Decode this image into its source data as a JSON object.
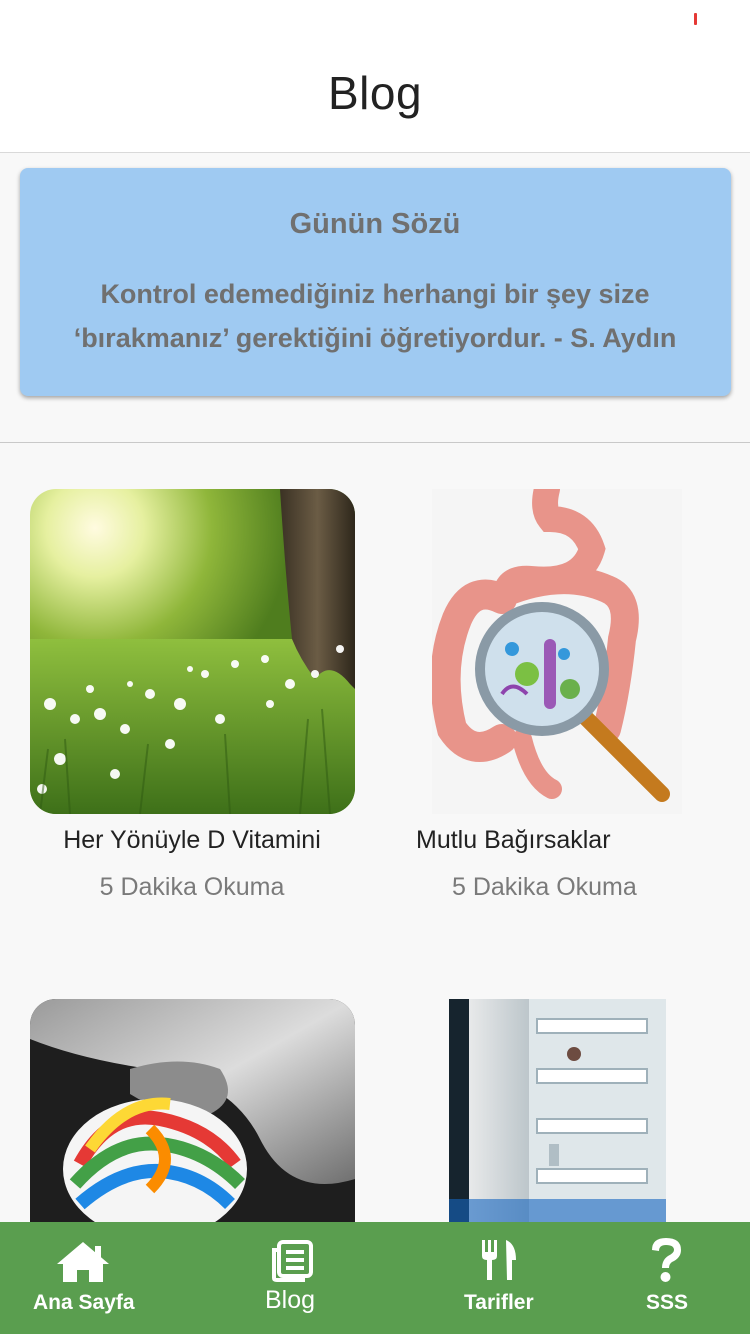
{
  "header": {
    "title": "Blog"
  },
  "quote": {
    "title": "Günün Sözü",
    "line1": "Kontrol edemediğiniz herhangi bir şey size",
    "line2": "‘bırakmanız’ gerektiğini öğretiyordur. - S. Aydın",
    "background": "#9fcaf2"
  },
  "posts": [
    {
      "title": "Her Yönüyle D Vitamini",
      "meta": "5 Dakika Okuma",
      "image": "sunlit-meadow-tree"
    },
    {
      "title": "Mutlu Bağırsaklar",
      "meta": "5 Dakika Okuma",
      "image": "intestine-magnifier"
    },
    {
      "title": "",
      "meta": "",
      "image": "child-lollipop"
    },
    {
      "title": "",
      "meta": "",
      "image": "open-refrigerator"
    }
  ],
  "nav": {
    "background": "#5a9e4f",
    "items": [
      {
        "label": "Ana Sayfa",
        "icon": "home-icon"
      },
      {
        "label": "Blog",
        "icon": "newspaper-icon"
      },
      {
        "label": "Tarifler",
        "icon": "fork-knife-icon"
      },
      {
        "label": "SSS",
        "icon": "question-icon"
      }
    ]
  }
}
